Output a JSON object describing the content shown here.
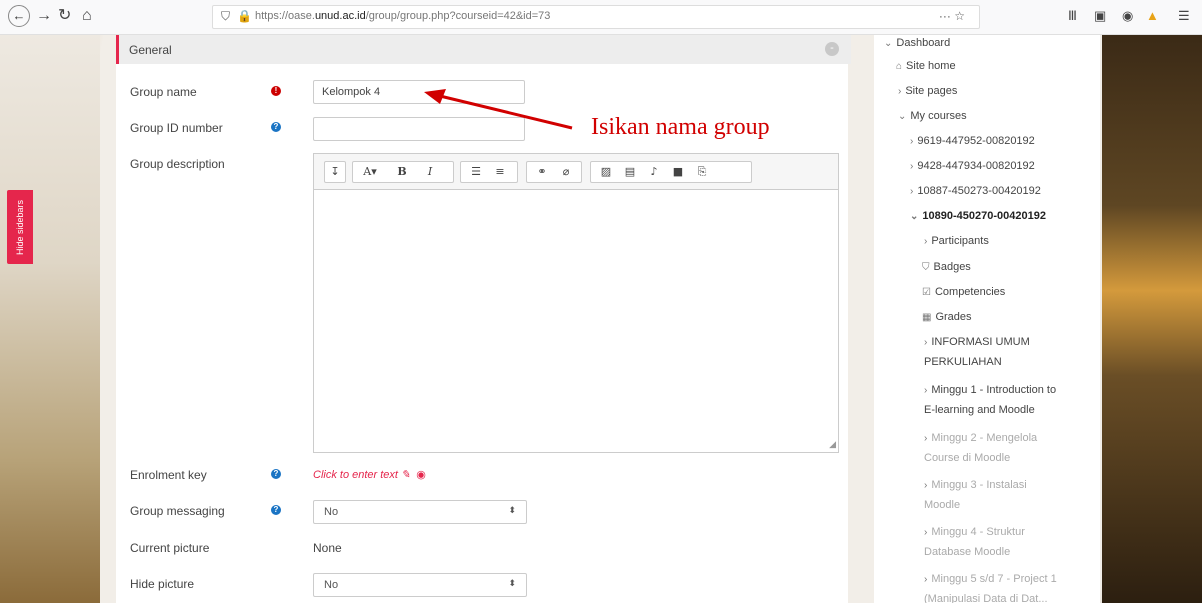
{
  "browser": {
    "url_prefix": "https://oase.",
    "url_domain": "unud.ac.id",
    "url_path": "/group/group.php?courseid=42&id=73",
    "url_actions": "··· ☆"
  },
  "sidebar_toggle": {
    "label": "Hide sidebars"
  },
  "form": {
    "section_title": "General",
    "collapse_symbol": "-",
    "fields": {
      "group_name": {
        "label": "Group name",
        "value": "Kelompok 4"
      },
      "group_id_number": {
        "label": "Group ID number",
        "value": ""
      },
      "group_description": {
        "label": "Group description"
      },
      "enrolment_key": {
        "label": "Enrolment key",
        "link": "Click to enter text"
      },
      "group_messaging": {
        "label": "Group messaging",
        "value": "No"
      },
      "current_picture": {
        "label": "Current picture",
        "value": "None"
      },
      "hide_picture": {
        "label": "Hide picture",
        "value": "No"
      }
    }
  },
  "annotation": {
    "text": "Isikan nama group",
    "color": "#d10000"
  },
  "nav": {
    "dashboard": "Dashboard",
    "site_home": "Site home",
    "site_pages": "Site pages",
    "my_courses": "My courses",
    "courses": [
      "9619-447952-00820192",
      "9428-447934-00820192",
      "10887-450273-00420192"
    ],
    "current_course": "10890-450270-00420192",
    "course_items": [
      "Participants",
      "Badges",
      "Competencies",
      "Grades"
    ],
    "sections": [
      [
        "INFORMASI UMUM",
        "PERKULIAHAN"
      ],
      [
        "Minggu 1 - Introduction to",
        "E-learning and Moodle"
      ],
      [
        "Minggu 2 - Mengelola",
        "Course di Moodle"
      ],
      [
        "Minggu 3 - Instalasi",
        "Moodle"
      ],
      [
        "Minggu 4 - Struktur",
        "Database Moodle"
      ],
      [
        "Minggu 5 s/d 7 - Project 1",
        "(Manipulasi Data di Dat..."
      ]
    ]
  },
  "colors": {
    "accent": "#e5264c",
    "required": "#cc0000",
    "help": "#1a74c4"
  }
}
